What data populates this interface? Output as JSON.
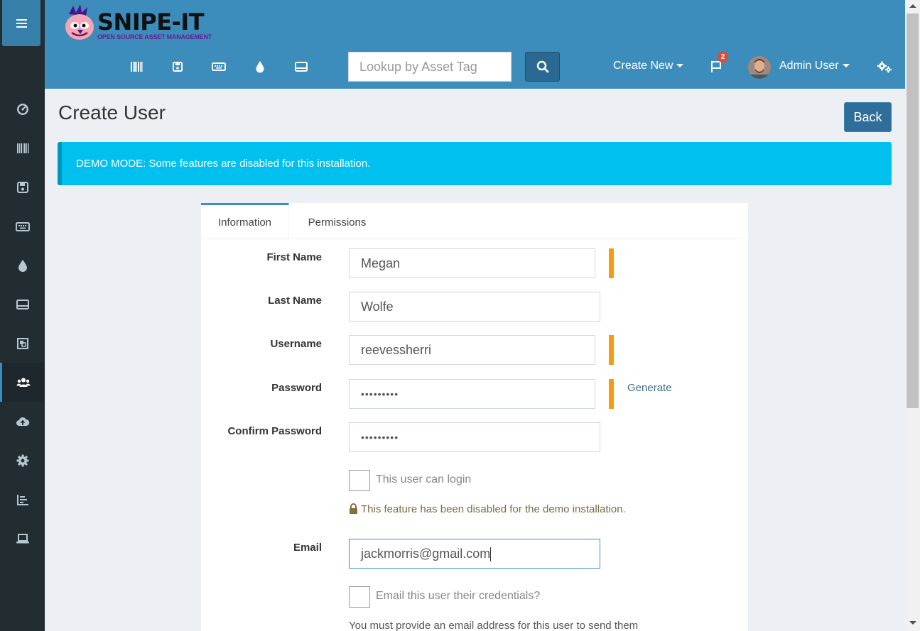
{
  "app": {
    "logo_title": "SNIPE-IT",
    "logo_subtitle": "OPEN SOURCE ASSET MANAGEMENT"
  },
  "header": {
    "search_placeholder": "Lookup by Asset Tag",
    "create_new_label": "Create New",
    "notification_count": "2",
    "user_name": "Admin User",
    "icons": [
      "barcode-icon",
      "save-icon",
      "keyboard-icon",
      "tint-icon",
      "drive-icon",
      "search-icon",
      "flag-icon",
      "cogs-icon"
    ]
  },
  "sidebar": {
    "items": [
      "dashboard-icon",
      "barcode-icon",
      "save-icon",
      "keyboard-icon",
      "tint-icon",
      "drive-icon",
      "components-icon",
      "users-icon",
      "cloud-upload-icon",
      "settings-icon",
      "reports-icon",
      "laptop-icon"
    ],
    "active": "users-icon"
  },
  "page": {
    "title": "Create User",
    "back_label": "Back",
    "alert": "DEMO MODE: Some features are disabled for this installation."
  },
  "tabs": {
    "information": "Information",
    "permissions": "Permissions"
  },
  "form": {
    "first_name_label": "First Name",
    "first_name_value": "Megan",
    "last_name_label": "Last Name",
    "last_name_value": "Wolfe",
    "username_label": "Username",
    "username_value": "reevessherri",
    "password_label": "Password",
    "password_value": "•••••••••",
    "generate_label": "Generate",
    "confirm_password_label": "Confirm Password",
    "confirm_password_value": "•••••••••",
    "can_login_label": "This user can login",
    "disabled_note": "This feature has been disabled for the demo installation.",
    "email_label": "Email",
    "email_value": "jackmorris@gmail.com",
    "email_credentials_label": "Email this user their credentials?",
    "email_help": "You must provide an email address for this user to send them"
  },
  "colors": {
    "header": "#3c8dbc",
    "sidebar": "#222d32",
    "alert": "#00c0ef",
    "required": "#f39c12"
  }
}
